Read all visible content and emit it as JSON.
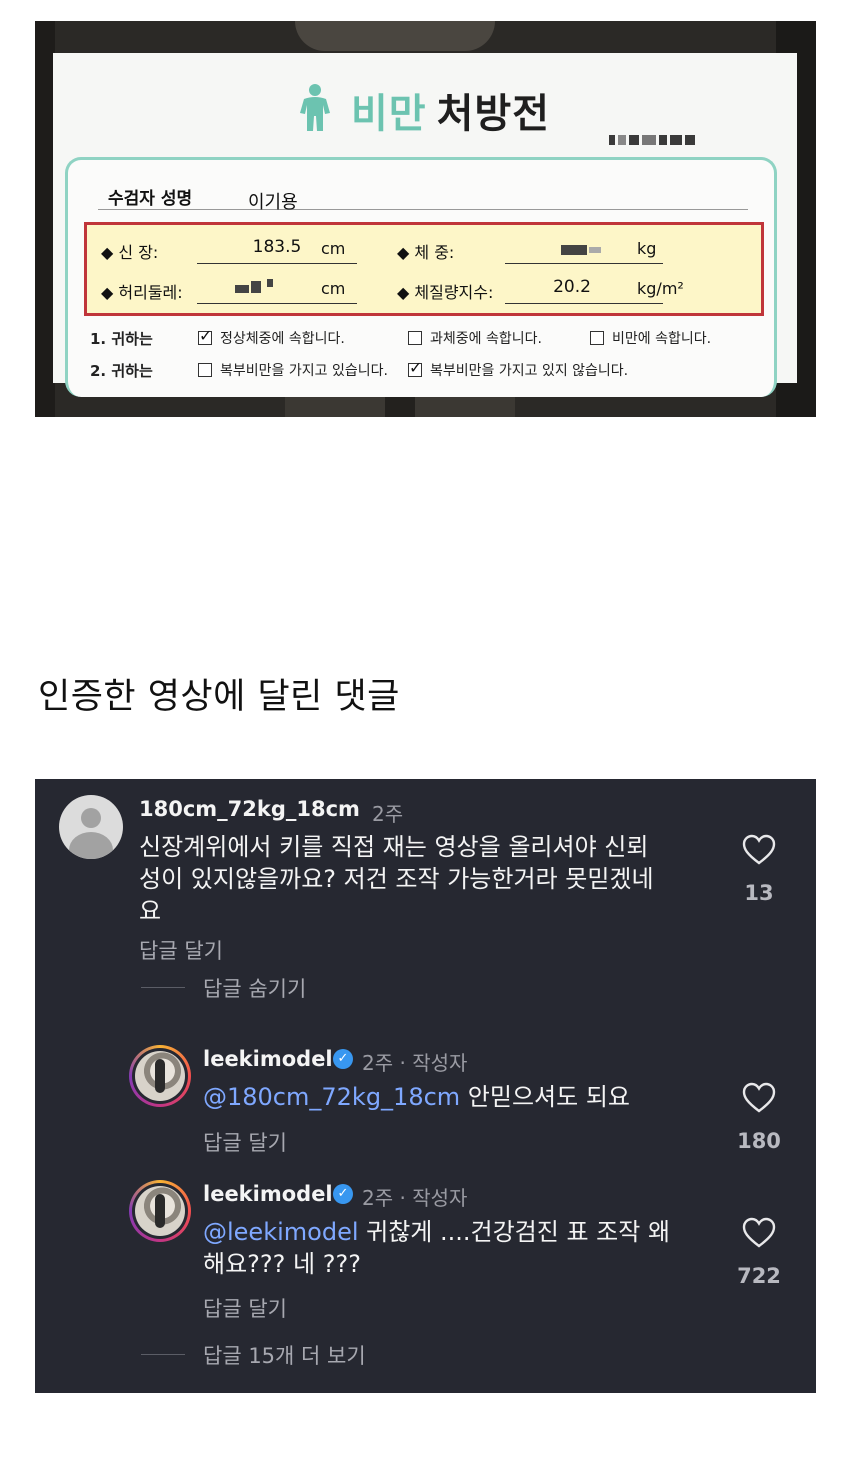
{
  "prescription": {
    "title_highlight": "비만",
    "title_rest": "처방전",
    "name_label": "수검자 성명",
    "name_value": "이기용",
    "height_label": "◆ 신    장:",
    "height_value": "183.5",
    "height_unit": "cm",
    "weight_label": "◆ 체    중:",
    "weight_unit": "kg",
    "waist_label": "◆ 허리둘레:",
    "waist_unit": "cm",
    "bmi_label": "◆ 체질량지수:",
    "bmi_value": "20.2",
    "bmi_unit": "kg/m²",
    "row1_label": "1. 귀하는",
    "row1_options": [
      {
        "label": "정상체중에 속합니다.",
        "checked": true
      },
      {
        "label": "과체중에 속합니다.",
        "checked": false
      },
      {
        "label": "비만에 속합니다.",
        "checked": false
      }
    ],
    "row2_label": "2. 귀하는",
    "row2_options": [
      {
        "label": "복부비만을 가지고 있습니다.",
        "checked": false
      },
      {
        "label": "복부비만을 가지고 있지 않습니다.",
        "checked": true
      }
    ]
  },
  "caption": "인증한 영상에 달린 댓글",
  "comments": {
    "main": {
      "username": "180cm_72kg_18cm",
      "time": "2주",
      "text_line1": "신장계위에서 키를 직접 재는 영상을 올리셔야 신뢰",
      "text_line2": "성이 있지않을까요? 저건 조작 가능한거라 못믿겠네",
      "text_line3": "요",
      "reply_label": "답글 달기",
      "likes": "13",
      "hide_replies": "답글 숨기기"
    },
    "reply1": {
      "username": "leekimodel",
      "meta": "2주 · 작성자",
      "mention": "@180cm_72kg_18cm",
      "text": " 안믿으셔도 되요",
      "reply_label": "답글 달기",
      "likes": "180"
    },
    "reply2": {
      "username": "leekimodel",
      "meta": "2주 · 작성자",
      "mention": "@leekimodel",
      "text_line1": " 귀찮게 ....건강검진 표 조작 왜",
      "text_line2": "해요??? 네 ???",
      "reply_label": "답글 달기",
      "likes": "722"
    },
    "more_replies": "답글 15개 더 보기"
  },
  "colors": {
    "panel_bg": "#262831",
    "mention": "#7fa8ff",
    "title_green": "#6cc3b0",
    "red_box": "#c0353a",
    "verified": "#3897f0"
  },
  "icons": [
    "person-icon",
    "heart-icon",
    "verified-badge-icon",
    "checkbox-icon"
  ]
}
